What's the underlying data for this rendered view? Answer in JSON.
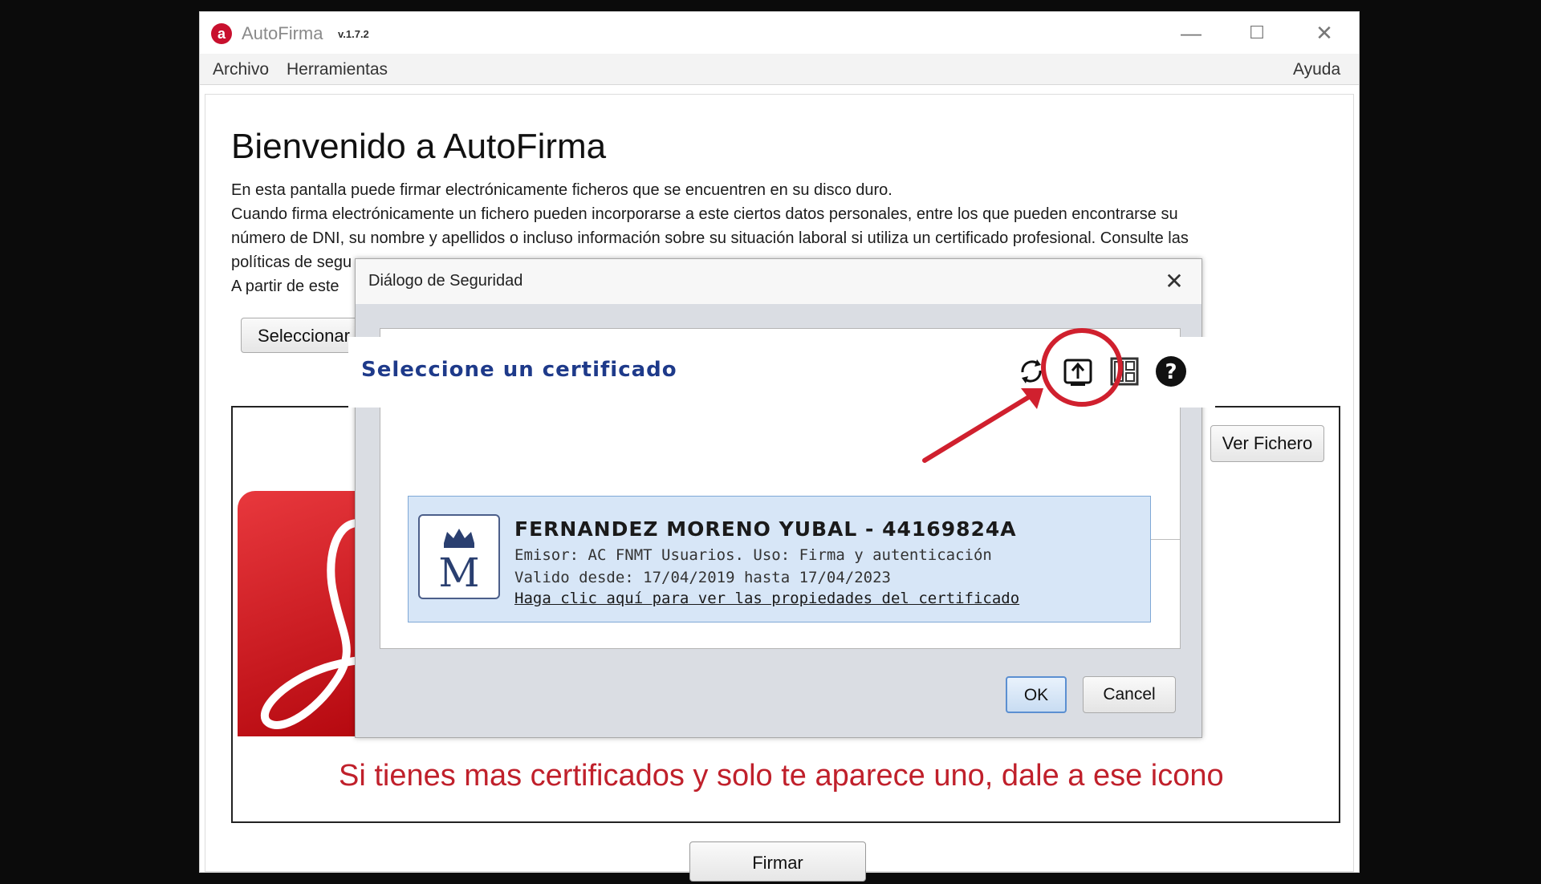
{
  "window": {
    "app_logo": "a",
    "title": "AutoFirma",
    "version": "v.1.7.2",
    "controls": {
      "minimize": "—",
      "maximize": "☐",
      "close": "✕"
    }
  },
  "menu": {
    "file": "Archivo",
    "tools": "Herramientas",
    "help": "Ayuda"
  },
  "main": {
    "heading": "Bienvenido a AutoFirma",
    "paragraphs": [
      "En esta pantalla puede firmar electrónicamente ficheros que se encuentren en su disco duro.",
      "Cuando firma electrónicamente un fichero pueden incorporarse a este ciertos datos personales, entre los que pueden encontrarse su",
      "número de DNI, su nombre y apellidos o incluso información sobre su situación laboral si utiliza un certificado profesional. Consulte las",
      "políticas de segu",
      "A partir de este"
    ],
    "select_file_button": "Seleccionar",
    "view_file_button": "Ver Fichero",
    "sign_button": "Firmar"
  },
  "dialog": {
    "title": "Diálogo de Seguridad",
    "close": "✕",
    "header_title": "Seleccione un certificado",
    "tools": [
      "refresh-icon",
      "import-icon",
      "view-toggle-icon",
      "help-icon"
    ],
    "certificate": {
      "name": "FERNANDEZ MORENO YUBAL - 44169824A",
      "issuer": "Emisor: AC FNMT Usuarios. Uso: Firma y autenticación",
      "validity": "Valido desde: 17/04/2019 hasta 17/04/2023",
      "link": "Haga clic aquí para ver las propiedades del certificado",
      "logo_letter": "M"
    },
    "ok_button": "OK",
    "cancel_button": "Cancel"
  },
  "annotation": {
    "caption": "Si tienes mas certificados y solo te aparece uno, dale a ese icono",
    "color": "#c0202b"
  },
  "colors": {
    "header_title": "#1e3a8a",
    "cert_item_bg": "#d7e6f7",
    "pdf_red": "#d4141c"
  }
}
